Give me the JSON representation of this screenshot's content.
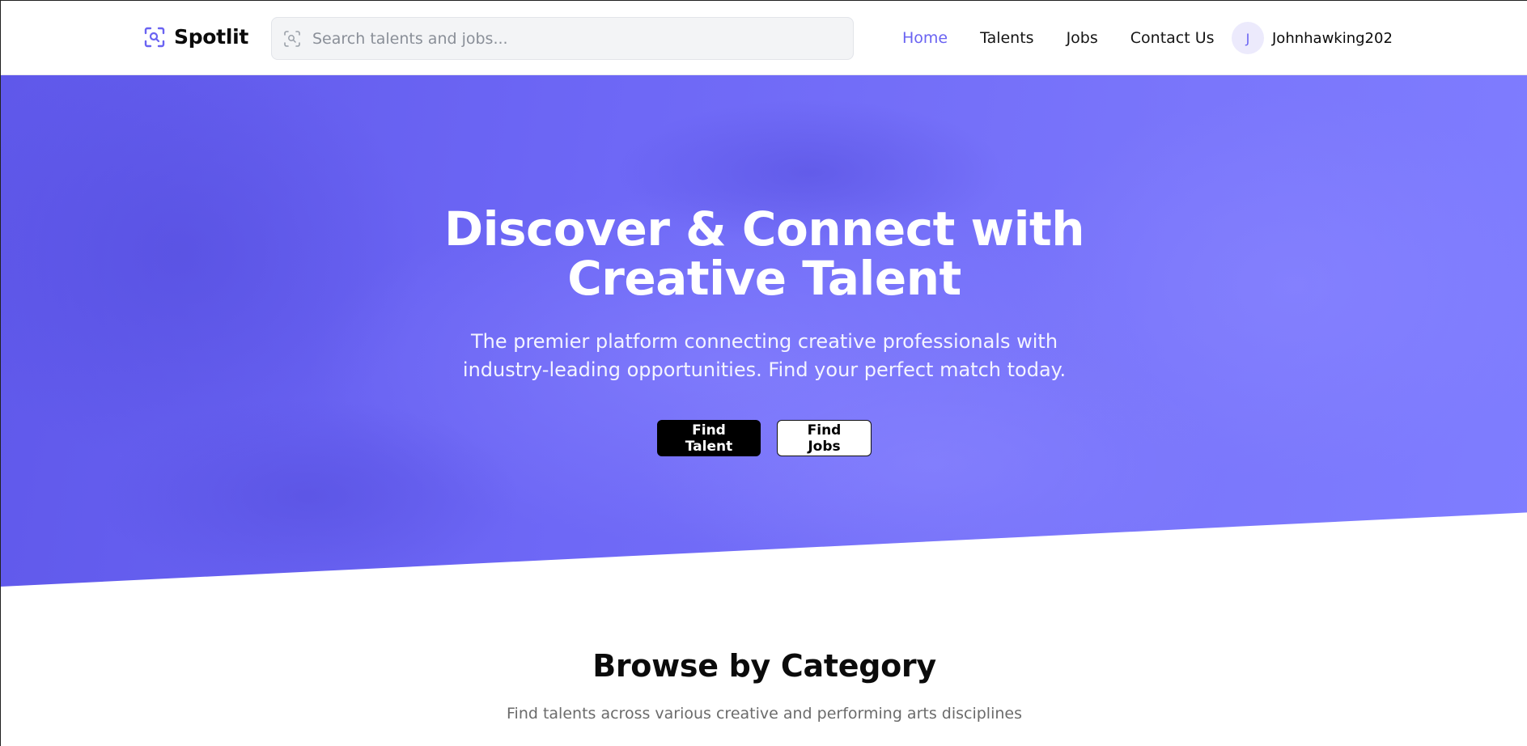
{
  "brand": {
    "name": "Spotlit",
    "icon": "search-scan-icon",
    "accent_color": "#6a63f2"
  },
  "search": {
    "placeholder": "Search talents and jobs...",
    "value": "",
    "icon": "search-icon"
  },
  "nav": {
    "links": [
      {
        "label": "Home",
        "active": true
      },
      {
        "label": "Talents",
        "active": false
      },
      {
        "label": "Jobs",
        "active": false
      },
      {
        "label": "Contact Us",
        "active": false
      }
    ]
  },
  "user": {
    "initial": "J",
    "username": "Johnhawking202"
  },
  "hero": {
    "title_line1": "Discover & Connect with",
    "title_line2": "Creative Talent",
    "subtitle": "The premier platform connecting creative professionals with industry-leading opportunities. Find your perfect match today.",
    "primary_button": "Find Talent",
    "secondary_button": "Find Jobs",
    "background_color": "#6e68f6"
  },
  "category": {
    "title": "Browse by Category",
    "subtitle": "Find talents across various creative and performing arts disciplines"
  }
}
